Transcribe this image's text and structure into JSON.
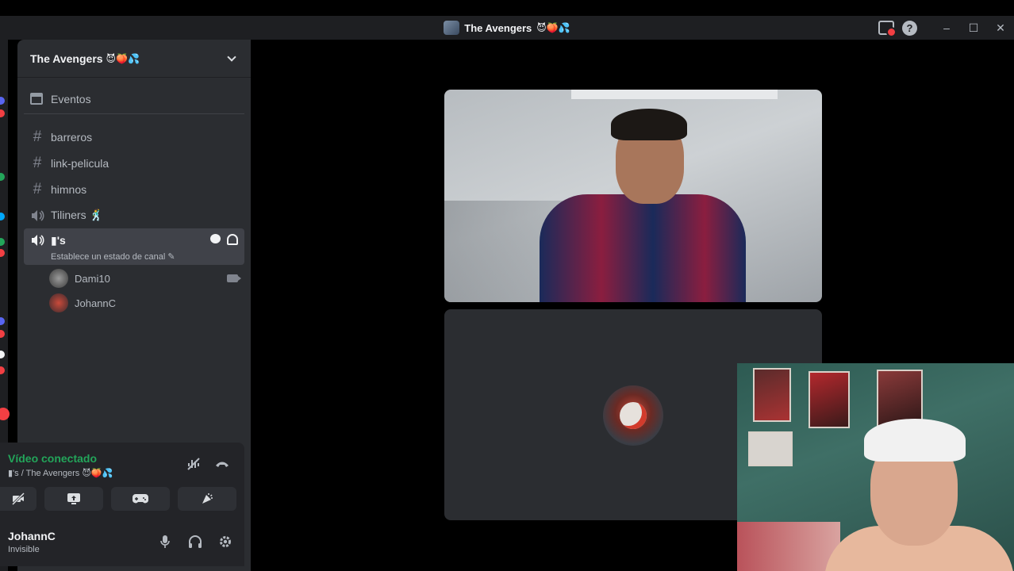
{
  "window": {
    "title": "The Avengers",
    "title_emojis": "😈🍑💦",
    "controls": {
      "minimize": "–",
      "maximize": "☐",
      "close": "✕"
    }
  },
  "server": {
    "name": "The Avengers",
    "name_emojis": "😈🍑💦"
  },
  "sidebar": {
    "events_label": "Eventos",
    "channels": [
      {
        "type": "text",
        "name": "barreros"
      },
      {
        "type": "text",
        "name": "link-pelicula"
      },
      {
        "type": "text",
        "name": "himnos"
      },
      {
        "type": "voice",
        "name": "Tiliners 🕺"
      }
    ],
    "active_channel": {
      "name": "▮'s",
      "status_prompt": "Establece un estado de canal ✎"
    },
    "voice_users": [
      {
        "name": "Dami10",
        "camera": true
      },
      {
        "name": "JohannC",
        "camera": false
      }
    ]
  },
  "voice_panel": {
    "status": "Vídeo conectado",
    "location": "▮'s / The Avengers 😈🍑💦"
  },
  "user_panel": {
    "username": "JohannC",
    "status": "Invisible"
  },
  "colors": {
    "connected_green": "#23a55a",
    "sidebar_bg": "#2b2d31",
    "active_channel_bg": "#404249",
    "notification_red": "#f23f43"
  }
}
